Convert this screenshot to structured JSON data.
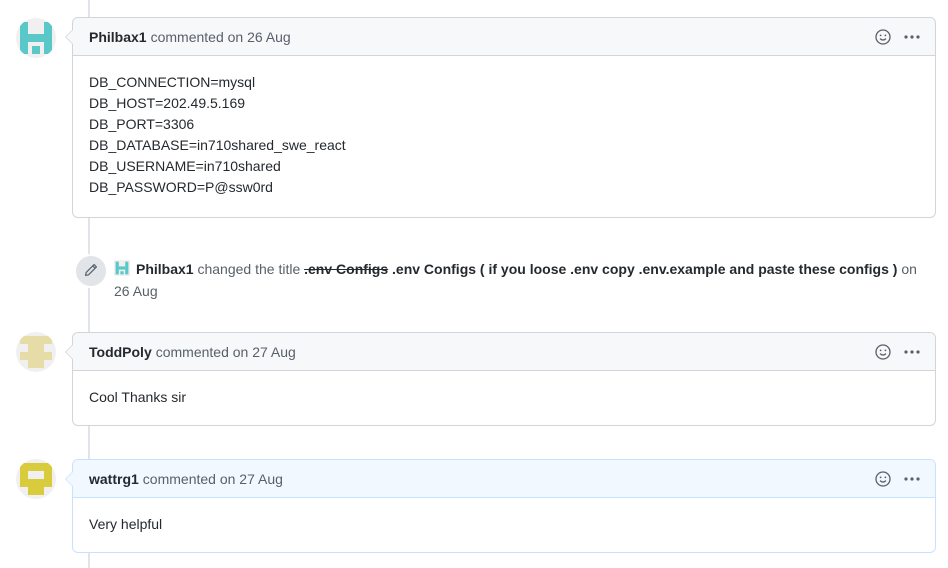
{
  "comments": [
    {
      "author": "Philbax1",
      "meta": "commented on 26 Aug",
      "lines": [
        "DB_CONNECTION=mysql",
        "DB_HOST=202.49.5.169",
        "DB_PORT=3306",
        "DB_DATABASE=in710shared_swe_react",
        "DB_USERNAME=in710shared",
        "DB_PASSWORD=P@ssw0rd"
      ]
    },
    {
      "author": "ToddPoly",
      "meta": "commented on 27 Aug",
      "body": "Cool Thanks sir"
    },
    {
      "author": "wattrg1",
      "meta": "commented on 27 Aug",
      "body": "Very helpful"
    }
  ],
  "event": {
    "actor": "Philbax1",
    "action": "changed the title",
    "old_title": ".env Configs",
    "new_title": ".env Configs ( if you loose .env copy .env.example and paste these configs )",
    "date": "on 26 Aug"
  },
  "colors": {
    "philbax_avatar": "#5ac8c8",
    "toddpoly_avatar": "#e6dca8",
    "wattrg_avatar": "#d8cc3c"
  },
  "icons": {
    "reaction": "smiley-icon",
    "menu": "kebab-horizontal-icon",
    "event": "pencil-icon"
  }
}
